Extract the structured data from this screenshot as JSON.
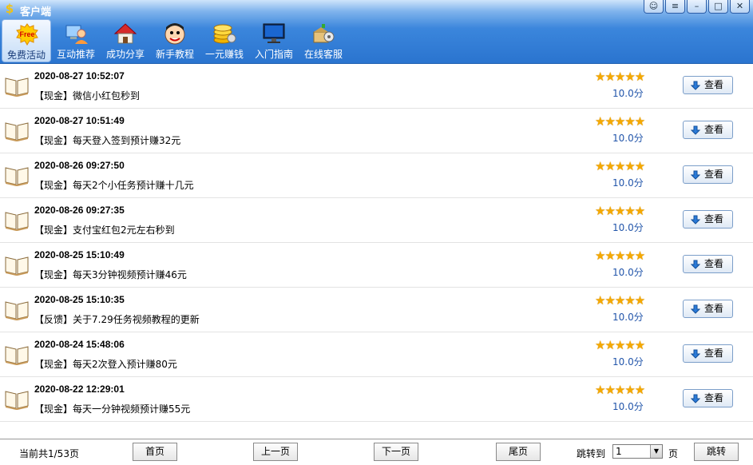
{
  "app": {
    "title": "客户端",
    "logo_glyph": "$"
  },
  "window_buttons": [
    {
      "name": "chat-icon",
      "glyph": "☺"
    },
    {
      "name": "menu-icon",
      "glyph": "≡"
    },
    {
      "name": "minimize-icon",
      "glyph": "–"
    },
    {
      "name": "maximize-icon",
      "glyph": "□"
    },
    {
      "name": "close-icon",
      "glyph": "✕"
    }
  ],
  "toolbar": [
    {
      "icon": "free-icon",
      "label": "免费活动",
      "active": true
    },
    {
      "icon": "computer-user-icon",
      "label": "互动推荐"
    },
    {
      "icon": "house-icon",
      "label": "成功分享"
    },
    {
      "icon": "face-icon",
      "label": "新手教程"
    },
    {
      "icon": "coins-icon",
      "label": "一元赚钱"
    },
    {
      "icon": "monitor-icon",
      "label": "入门指南"
    },
    {
      "icon": "box-gear-icon",
      "label": "在线客服"
    }
  ],
  "items": [
    {
      "date": "2020-08-27 10:52:07",
      "title": "【现金】微信小红包秒到",
      "stars": "★★★★★",
      "score": "10.0分",
      "button": "查看"
    },
    {
      "date": "2020-08-27 10:51:49",
      "title": "【现金】每天登入签到预计赚32元",
      "stars": "★★★★★",
      "score": "10.0分",
      "button": "查看"
    },
    {
      "date": "2020-08-26 09:27:50",
      "title": "【现金】每天2个小任务预计赚十几元",
      "stars": "★★★★★",
      "score": "10.0分",
      "button": "查看"
    },
    {
      "date": "2020-08-26 09:27:35",
      "title": "【现金】支付宝红包2元左右秒到",
      "stars": "★★★★★",
      "score": "10.0分",
      "button": "查看"
    },
    {
      "date": "2020-08-25 15:10:49",
      "title": "【现金】每天3分钟视频预计赚46元",
      "stars": "★★★★★",
      "score": "10.0分",
      "button": "查看"
    },
    {
      "date": "2020-08-25 15:10:35",
      "title": "【反馈】关于7.29任务视频教程的更新",
      "stars": "★★★★★",
      "score": "10.0分",
      "button": "查看"
    },
    {
      "date": "2020-08-24 15:48:06",
      "title": "【现金】每天2次登入预计赚80元",
      "stars": "★★★★★",
      "score": "10.0分",
      "button": "查看"
    },
    {
      "date": "2020-08-22 12:29:01",
      "title": "【现金】每天一分钟视频预计赚55元",
      "stars": "★★★★★",
      "score": "10.0分",
      "button": "查看"
    }
  ],
  "footer": {
    "page_info": "当前共1/53页",
    "first": "首页",
    "prev": "上一页",
    "next": "下一页",
    "last": "尾页",
    "jump_label": "跳转到",
    "jump_value": "1",
    "page_unit": "页",
    "go": "跳转"
  },
  "colors": {
    "header_blue": "#2a74cf",
    "star": "#f5a900",
    "score": "#2255aa"
  }
}
